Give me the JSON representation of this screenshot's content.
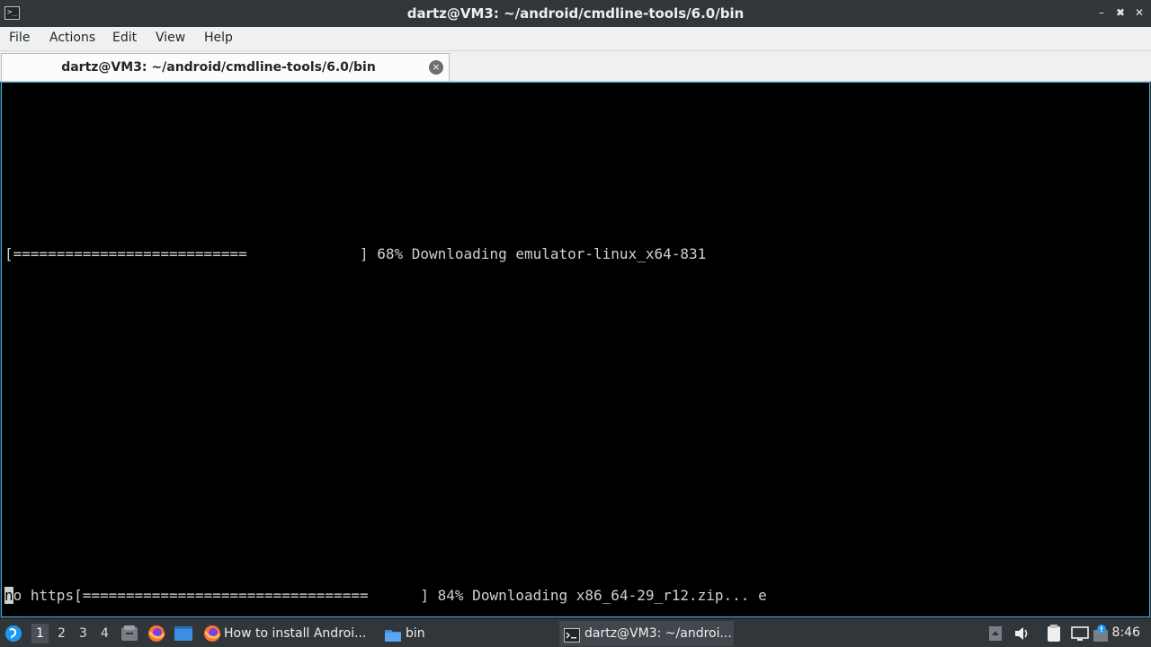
{
  "window": {
    "title": "dartz@VM3: ~/android/cmdline-tools/6.0/bin",
    "app_icon_glyph": ">_",
    "minimize_glyph": "–",
    "restore_glyph": "✖",
    "close_glyph": "✕"
  },
  "menu": {
    "file": "File",
    "actions": "Actions",
    "edit": "Edit",
    "view": "View",
    "help": "Help"
  },
  "tab": {
    "label": "dartz@VM3: ~/android/cmdline-tools/6.0/bin",
    "close_glyph": "×"
  },
  "terminal": {
    "line1": "[===========================             ] 68% Downloading emulator-linux_x64-831",
    "line2_cursor_char": "n",
    "line2_rest": "o https[=================================      ] 84% Downloading x86_64-29_r12.zip... e"
  },
  "taskbar": {
    "desktops": [
      "1",
      "2",
      "3",
      "4"
    ],
    "task_firefox": "How to install Androi...",
    "task_files": "bin",
    "task_terminal": "dartz@VM3: ~/androi...",
    "clock": "8:46"
  },
  "colors": {
    "terminal_bg": "#000000",
    "terminal_fg": "#d0d0d0",
    "focus_border": "#3daee9",
    "panel_bg": "#31363b"
  }
}
